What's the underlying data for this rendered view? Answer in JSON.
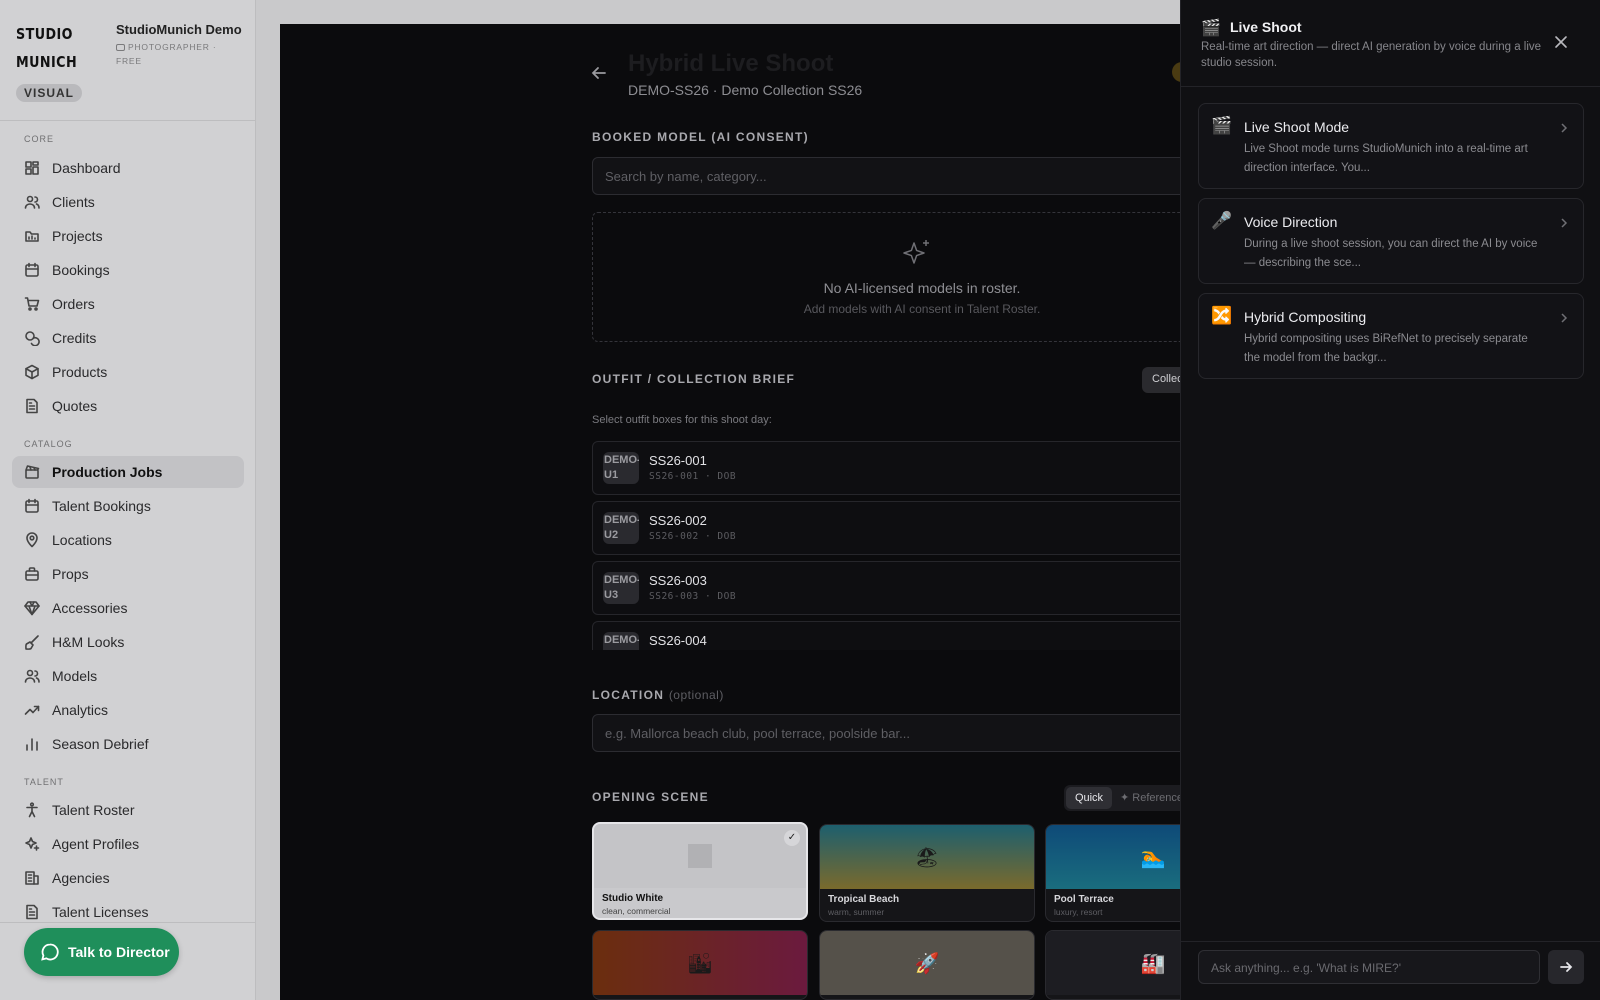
{
  "sidebar": {
    "brand_line1": "STUDIO",
    "brand_line2": "MUNICH",
    "org_name": "StudioMunich Demo",
    "org_meta": "PHOTOGRAPHER · FREE",
    "badge": "VISUAL",
    "sections": {
      "core": "CORE",
      "catalog": "CATALOG",
      "talent": "TALENT"
    },
    "core_items": [
      "Dashboard",
      "Clients",
      "Projects",
      "Bookings",
      "Orders",
      "Credits",
      "Products",
      "Quotes"
    ],
    "catalog_items": [
      "Production Jobs",
      "Talent Bookings",
      "Locations",
      "Props",
      "Accessories",
      "H&M Looks",
      "Models",
      "Analytics",
      "Season Debrief"
    ],
    "talent_items": [
      "Talent Roster",
      "Agent Profiles",
      "Agencies",
      "Talent Licenses"
    ],
    "active_item": "Production Jobs",
    "talk_button": "Talk to Director"
  },
  "main": {
    "title": "Hybrid Live Shoot",
    "subtitle": "DEMO-SS26 · Demo Collection SS26",
    "booked_label": "BOOKED MODEL (AI CONSENT)",
    "search_placeholder": "Search by name, category...",
    "empty_title": "No AI-licensed models in roster.",
    "empty_sub": "Add models with AI consent in Talent Roster.",
    "outfit_label": "OUTFIT / COLLECTION BRIEF",
    "outfit_chip": "Collec",
    "outfit_hint": "Select outfit boxes for this shoot day:",
    "outfits": [
      {
        "thumb": "DEMO-U1",
        "title": "SS26-001",
        "code": "SS26-001 · DOB"
      },
      {
        "thumb": "DEMO-U2",
        "title": "SS26-002",
        "code": "SS26-002 · DOB"
      },
      {
        "thumb": "DEMO-U3",
        "title": "SS26-003",
        "code": "SS26-003 · DOB"
      },
      {
        "thumb": "DEMO-",
        "title": "SS26-004",
        "code": ""
      }
    ],
    "location_label": "LOCATION",
    "location_optional": "(optional)",
    "location_placeholder": "e.g. Mallorca beach club, pool terrace, poolside bar...",
    "scene_label": "OPENING SCENE",
    "seg_quick": "Quick",
    "seg_reference": "Reference",
    "scenes": [
      {
        "name": "Studio White",
        "tags": "clean, commercial",
        "emoji": ""
      },
      {
        "name": "Tropical Beach",
        "tags": "warm, summer",
        "emoji": "🏖"
      },
      {
        "name": "Pool Terrace",
        "tags": "luxury, resort",
        "emoji": "🏊"
      },
      {
        "name": "",
        "tags": "",
        "emoji": "🏙"
      },
      {
        "name": "",
        "tags": "",
        "emoji": "🚀"
      },
      {
        "name": "",
        "tags": "",
        "emoji": "🏭"
      }
    ]
  },
  "panel": {
    "title": "Live Shoot",
    "icon": "🎬",
    "subtitle": "Real-time art direction — direct AI generation by voice during a live studio session.",
    "cards": [
      {
        "icon": "🎬",
        "title": "Live Shoot Mode",
        "desc": "Live Shoot mode turns StudioMunich into a real-time art direction interface. You..."
      },
      {
        "icon": "🎤",
        "title": "Voice Direction",
        "desc": "During a live shoot session, you can direct the AI by voice — describing the sce..."
      },
      {
        "icon": "🔀",
        "title": "Hybrid Compositing",
        "desc": "Hybrid compositing uses BiRefNet to precisely separate the model from the backgr..."
      }
    ],
    "ask_placeholder": "Ask anything... e.g. 'What is MIRE?'"
  }
}
